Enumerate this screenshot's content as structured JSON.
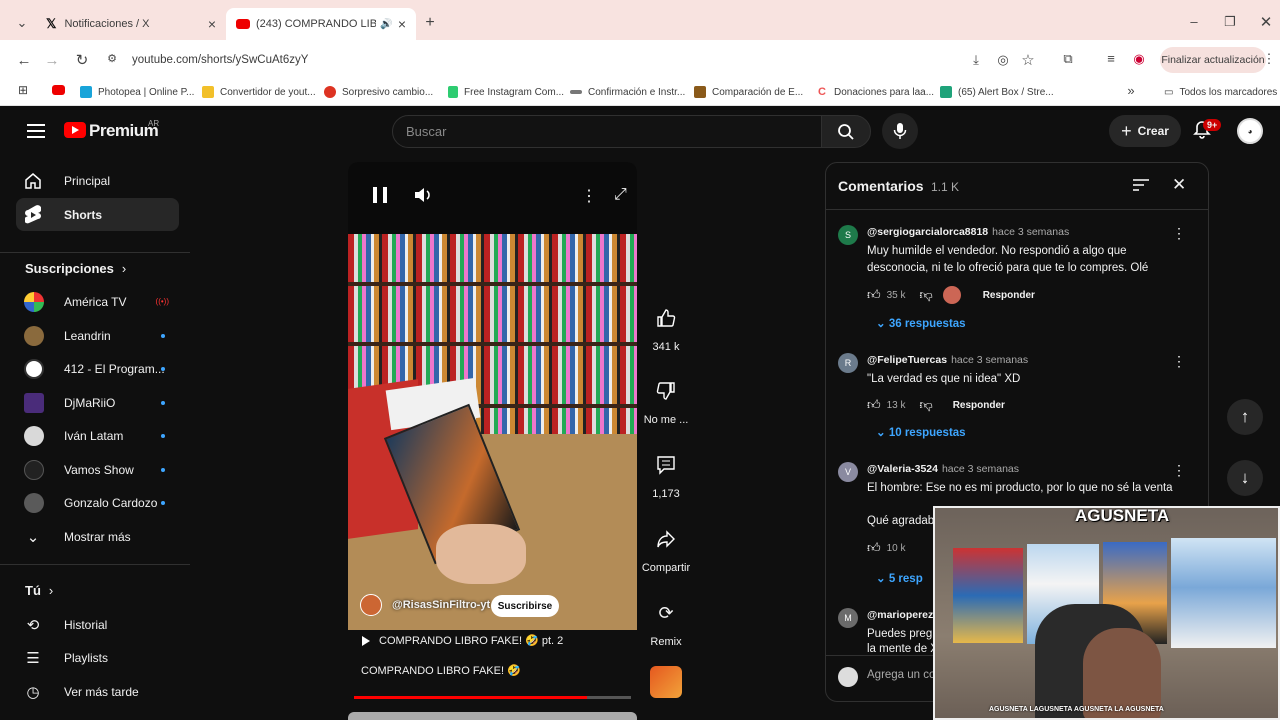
{
  "browser": {
    "tabs": [
      {
        "title": "Notificaciones / X"
      },
      {
        "title": "(243) COMPRANDO LIBRO F"
      }
    ],
    "url": "youtube.com/shorts/ySwCuAt6zyY",
    "update_label": "Finalizar actualización",
    "bookmarks": [
      "Photopea | Online P...",
      "Convertidor de yout...",
      "Sorpresivo cambio...",
      "Free Instagram Com...",
      "Confirmación e Instr...",
      "Comparación de E...",
      "Donaciones para laa...",
      "(65) Alert Box / Stre..."
    ],
    "all_bookmarks": "Todos los marcadores"
  },
  "header": {
    "logo": "Premium",
    "region": "AR",
    "search_placeholder": "Buscar",
    "create_label": "Crear",
    "notif_badge": "9+"
  },
  "sidebar": {
    "home": "Principal",
    "shorts": "Shorts",
    "subscriptions_title": "Suscripciones",
    "channels": [
      {
        "name": "América TV",
        "color": "#e8e8e8"
      },
      {
        "name": "Leandrin",
        "color": "#8a6a3d"
      },
      {
        "name": "412 - El Program...",
        "color": "#ffffff"
      },
      {
        "name": "DjMaRiiO",
        "color": "#4a2c7a"
      },
      {
        "name": "Iván Latam",
        "color": "#d9d9d9"
      },
      {
        "name": "Vamos Show",
        "color": "#222222"
      },
      {
        "name": "Gonzalo Cardozo",
        "color": "#5a5a5a"
      }
    ],
    "show_more": "Mostrar más",
    "you_title": "Tú",
    "history": "Historial",
    "playlists": "Playlists",
    "watch_later": "Ver más tarde"
  },
  "video": {
    "channel": "@RisasSinFiltro-yt",
    "subscribe": "Suscribirse",
    "playlist_title": "COMPRANDO LIBRO FAKE! 🤣 pt. 2",
    "title": "COMPRANDO LIBRO FAKE! 🤣",
    "progress": 0.84
  },
  "actions": {
    "likes": "341 k",
    "dislike": "No me ...",
    "comments": "1,173",
    "share": "Compartir",
    "remix": "Remix"
  },
  "comments_panel": {
    "title": "Comentarios",
    "count": "1.1 K",
    "items": [
      {
        "initial": "S",
        "color": "#1e7a4a",
        "user": "@sergiogarcialorca8818",
        "time": "hace 3 semanas",
        "text": "Muy humilde el vendedor. No respondió a algo que desconocia, ni te lo ofreció para que te lo compres. Olé",
        "likes": "35 k",
        "reply": "Responder",
        "replies": "36 respuestas"
      },
      {
        "initial": "R",
        "color": "#6b7b8c",
        "user": "@FelipeTuercas",
        "time": "hace 3 semanas",
        "text": "\"La verdad es que ni idea\" XD",
        "likes": "13 k",
        "reply": "Responder",
        "replies": "10 respuestas"
      },
      {
        "initial": "V",
        "color": "#8a8aa0",
        "user": "@Valeria-3524",
        "time": "hace 3 semanas",
        "text": "El hombre: Ese no es mi producto, por lo que no sé la venta",
        "text2": "Qué agradabl",
        "likes": "10 k",
        "replies": "5 resp"
      },
      {
        "initial": "M",
        "color": "#6b6b6b",
        "user": "@marioperez",
        "text": "Puedes pregu",
        "text2": "la mente de X"
      }
    ],
    "add_placeholder": "Agrega un co"
  },
  "stream": {
    "watermark": "LA AGUSNETA",
    "socials": "AGUSNETA  LAGUSNETA  AGUSNETA  LA AGUSNETA"
  }
}
